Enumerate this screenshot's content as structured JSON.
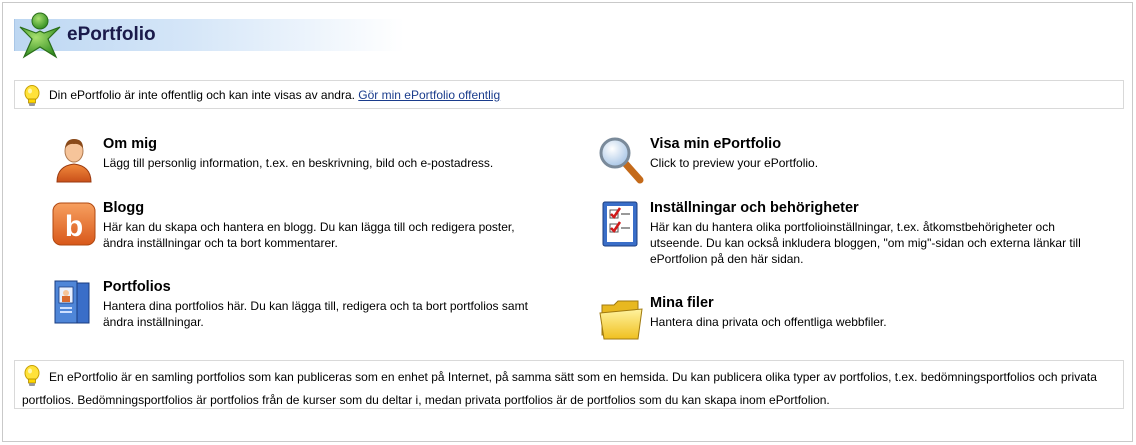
{
  "header": {
    "title": "ePortfolio",
    "logo_icon": "person-star-icon"
  },
  "notice_top": {
    "text": "Din ePortfolio är inte offentlig och kan inte visas av andra. ",
    "link": "Gör min ePortfolio offentlig",
    "icon": "lightbulb-icon"
  },
  "items": {
    "om_mig": {
      "title": "Om mig",
      "description": "Lägg till personlig information, t.ex. en beskrivning, bild och e-postadress.",
      "icon": "user-icon"
    },
    "blogg": {
      "title": "Blogg",
      "description": "Här kan du skapa och hantera en blogg. Du kan lägga till och redigera poster, ändra inställningar och ta bort kommentarer.",
      "icon": "blog-icon",
      "icon_letter": "b"
    },
    "portfolios": {
      "title": "Portfolios",
      "description": "Hantera dina portfolios här. Du kan lägga till, redigera och ta bort portfolios samt ändra inställningar.",
      "icon": "portfolio-binders-icon"
    },
    "visa": {
      "title": "Visa min ePortfolio",
      "description": "Click to preview your ePortfolio.",
      "icon": "magnifier-icon"
    },
    "installningar": {
      "title": "Inställningar och behörigheter",
      "description": "Här kan du hantera olika portfolioinställningar, t.ex. åtkomstbehörigheter och utseende. Du kan också inkludera bloggen, \"om mig\"-sidan och externa länkar till ePortfolion på den här sidan.",
      "icon": "checklist-icon"
    },
    "filer": {
      "title": "Mina filer",
      "description": "Hantera dina privata och offentliga webbfiler.",
      "icon": "folder-icon"
    }
  },
  "notice_bottom": {
    "text": "En ePortfolio är en samling portfolios som kan publiceras som en enhet på Internet, på samma sätt som en hemsida. Du kan publicera olika typer av portfolios, t.ex. bedömningsportfolios och privata portfolios. Bedömningsportfolios är portfolios från de kurser som du deltar i, medan privata portfolios är de portfolios som du kan skapa inom ePortfolion.",
    "icon": "lightbulb-icon"
  },
  "colors": {
    "title_text": "#1a1a4a",
    "link": "#1a3c8c",
    "header_gradient": "#bdd7f2",
    "border": "#d9d9d9"
  }
}
